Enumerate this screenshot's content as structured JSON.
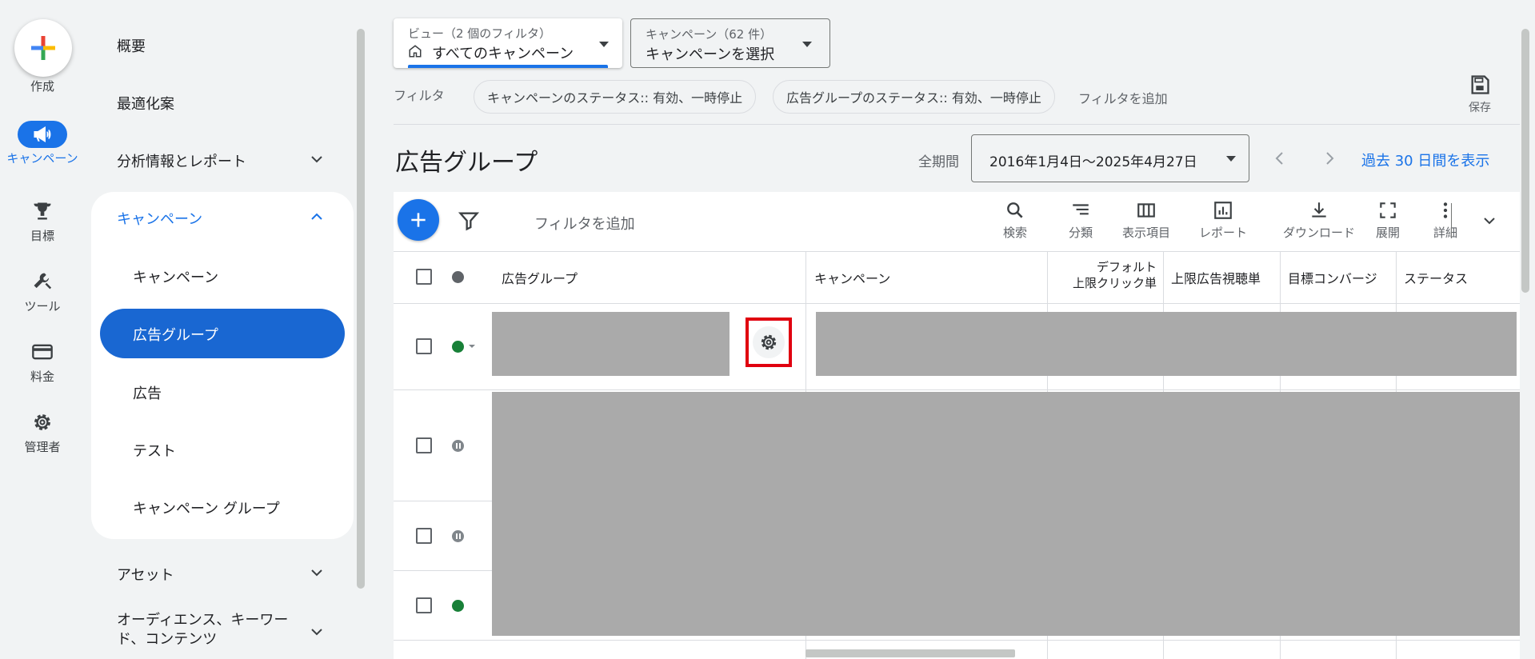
{
  "rail": {
    "create_label": "作成",
    "campaigns_label": "キャンペーン",
    "goals_label": "目標",
    "tools_label": "ツール",
    "billing_label": "料金",
    "admin_label": "管理者"
  },
  "nav": {
    "overview": "概要",
    "recommendations": "最適化案",
    "insights": "分析情報とレポート",
    "campaigns_section": "キャンペーン",
    "sub_campaigns": "キャンペーン",
    "sub_ad_groups": "広告グループ",
    "sub_ads": "広告",
    "sub_experiments": "テスト",
    "sub_campaign_groups": "キャンペーン グループ",
    "assets": "アセット",
    "audiences": "オーディエンス、キーワー",
    "audiences_line2": "ド、コンテンツ"
  },
  "view": {
    "filter_label": "ビュー（2 個のフィルタ）",
    "value": "すべてのキャンペーン"
  },
  "campaign_select": {
    "count_label": "キャンペーン（62 件）",
    "value": "キャンペーンを選択"
  },
  "filters": {
    "label": "フィルタ",
    "chips": [
      "キャンペーンのステータス:: 有効、一時停止",
      "広告グループのステータス:: 有効、一時停止"
    ],
    "add": "フィルタを追加"
  },
  "save_label": "保存",
  "page_title": "広告グループ",
  "date": {
    "period_label": "全期間",
    "range": "2016年1月4日〜2025年4月27日",
    "last30": "過去 30 日間を表示"
  },
  "toolbar": {
    "add_filter": "フィルタを追加",
    "search": "検索",
    "segment": "分類",
    "columns": "表示項目",
    "reports": "レポート",
    "download": "ダウンロード",
    "expand": "展開",
    "more": "詳細"
  },
  "table": {
    "headers": {
      "ad_group": "広告グループ",
      "campaign": "キャンペーン",
      "default_cpc_line1": "デフォルト",
      "default_cpc_line2": "上限クリック単",
      "max_cpv": "上限広告視聴単",
      "target_conv": "目標コンバージ",
      "status": "ステータス"
    }
  },
  "colors": {
    "accent": "#1a73e8",
    "enabled": "#188038",
    "highlight": "#e0000f"
  }
}
